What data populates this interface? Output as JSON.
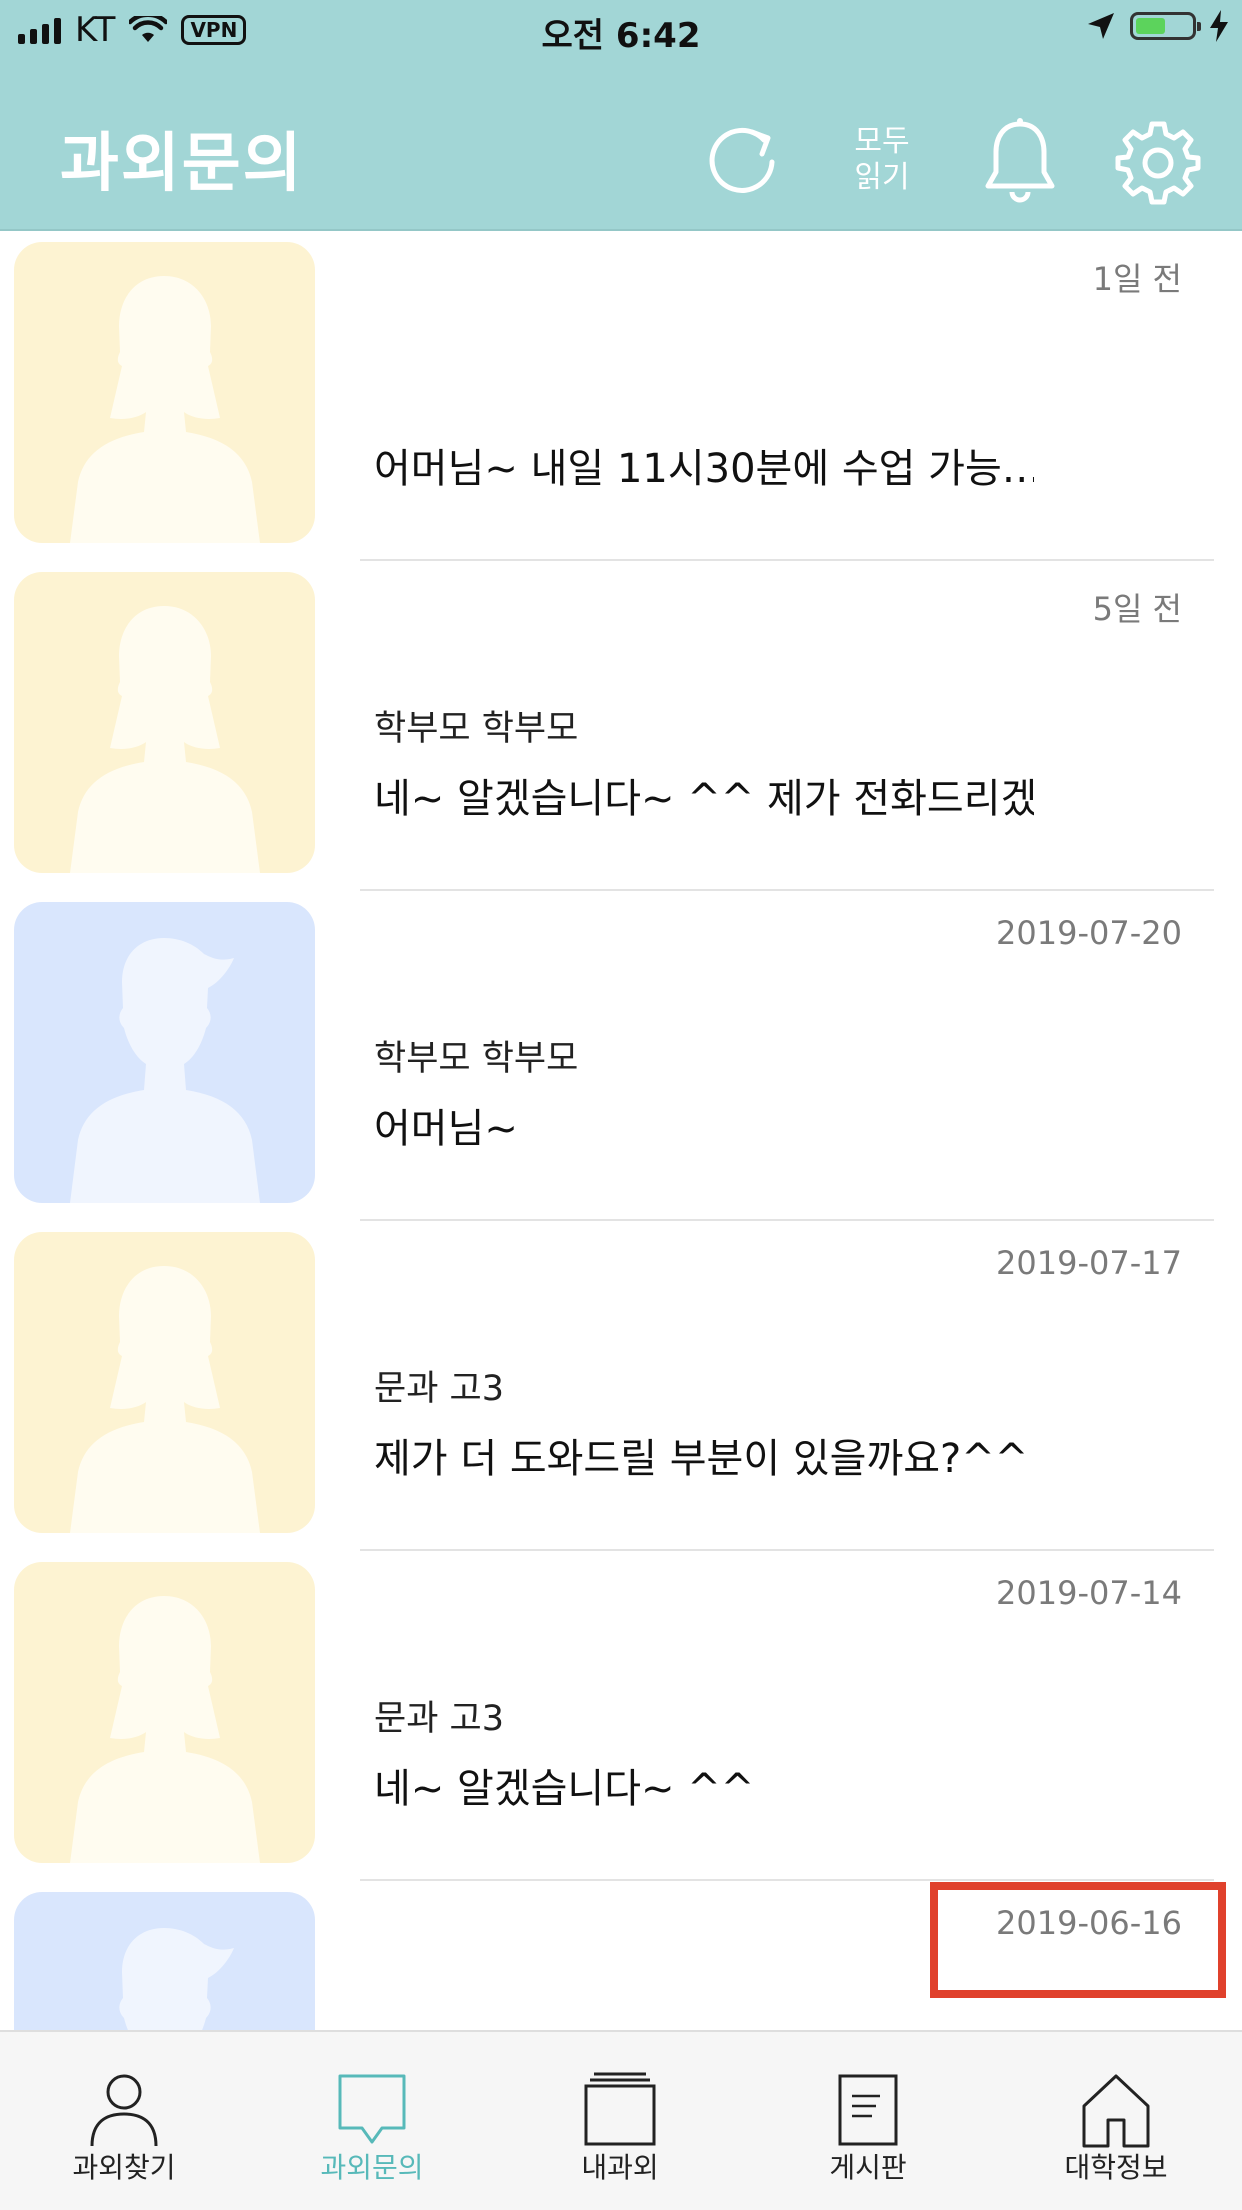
{
  "status_bar": {
    "carrier": "KT",
    "vpn_label": "VPN",
    "time": "오전 6:42"
  },
  "header": {
    "title": "과외문의",
    "read_all_line1": "모두",
    "read_all_line2": "읽기"
  },
  "colors": {
    "header_bg": "#a2d6d6",
    "accent": "#57b9b9",
    "avatar_yellow": "#fdf3d2",
    "avatar_blue": "#d9e6fd",
    "highlight": "#e0412c"
  },
  "inquiries": [
    {
      "avatar": "female-avatar-icon",
      "date": "1일 전",
      "sender": "",
      "message": "어머님~ 내일 11시30분에 수업 가능…"
    },
    {
      "avatar": "female-avatar-icon",
      "date": "5일 전",
      "sender": "학부모 학부모",
      "message": "네~ 알겠습니다~ ^^ 제가 전화드리겠…"
    },
    {
      "avatar": "male-avatar-icon",
      "date": "2019-07-20",
      "sender": "학부모 학부모",
      "message": "어머님~"
    },
    {
      "avatar": "female-avatar-icon",
      "date": "2019-07-17",
      "sender": "문과 고3",
      "message": "제가 더 도와드릴 부분이 있을까요?^^"
    },
    {
      "avatar": "female-avatar-icon",
      "date": "2019-07-14",
      "sender": "문과 고3",
      "message": "네~ 알겠습니다~ ^^"
    },
    {
      "avatar": "male-avatar-icon",
      "date": "2019-06-16",
      "sender": "",
      "message": ""
    }
  ],
  "tabs": [
    {
      "label": "과외찾기",
      "icon": "person-icon",
      "active": false
    },
    {
      "label": "과외문의",
      "icon": "chat-bubble-icon",
      "active": true
    },
    {
      "label": "내과외",
      "icon": "stacked-cards-icon",
      "active": false
    },
    {
      "label": "게시판",
      "icon": "document-icon",
      "active": false
    },
    {
      "label": "대학정보",
      "icon": "house-icon",
      "active": false
    }
  ]
}
